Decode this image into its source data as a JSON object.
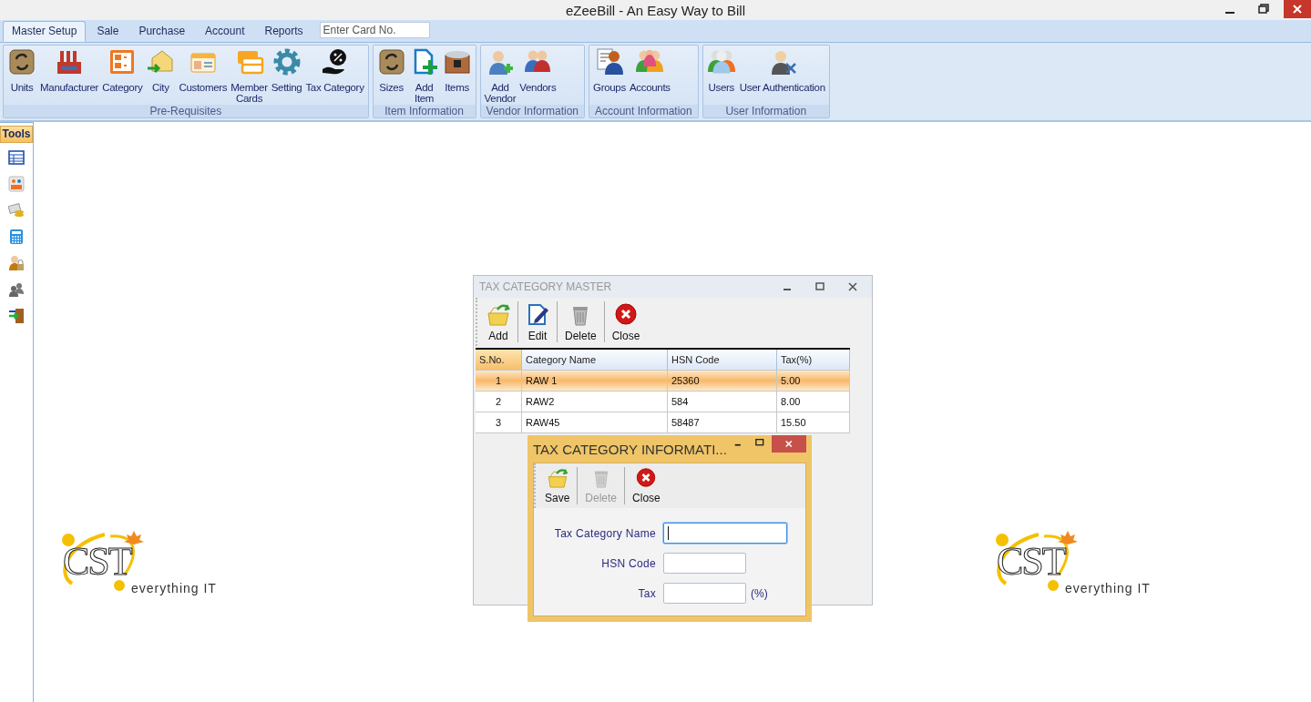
{
  "window": {
    "title": "eZeeBill - An Easy Way to Bill"
  },
  "tabs": [
    {
      "label": "Master Setup",
      "selected": true
    },
    {
      "label": "Sale",
      "selected": false
    },
    {
      "label": "Purchase",
      "selected": false
    },
    {
      "label": "Account",
      "selected": false
    },
    {
      "label": "Reports",
      "selected": false
    }
  ],
  "card_search": {
    "placeholder": "Enter Card No."
  },
  "ribbon_groups": [
    {
      "caption": "Pre-Requisites",
      "items": [
        "Units",
        "Manufacturer",
        "Category",
        "City",
        "Customers",
        "Member\nCards",
        "Setting",
        "Tax Category"
      ]
    },
    {
      "caption": "Item Information",
      "items": [
        "Sizes",
        "Add\nItem",
        "Items"
      ]
    },
    {
      "caption": "Vendor Information",
      "items": [
        "Add\nVendor",
        "Vendors"
      ]
    },
    {
      "caption": "Account Information",
      "items": [
        "Groups",
        "Accounts"
      ]
    },
    {
      "caption": "User Information",
      "items": [
        "Users",
        "User Authentication"
      ]
    }
  ],
  "tools": {
    "title": "Tools"
  },
  "logos": [
    {
      "mark": "CST",
      "tagline": "everything IT"
    },
    {
      "mark": "CST",
      "tagline": "everything IT"
    }
  ],
  "tax_master": {
    "title": "TAX CATEGORY MASTER",
    "active": false,
    "toolbar": [
      {
        "label": "Add",
        "disabled": false
      },
      {
        "label": "Edit",
        "disabled": false
      },
      {
        "label": "Delete",
        "disabled": false
      },
      {
        "label": "Close",
        "disabled": false
      }
    ],
    "columns": [
      "S.No.",
      "Category Name",
      "HSN Code",
      "Tax(%)"
    ],
    "rows": [
      {
        "cells": [
          "1",
          "RAW 1",
          "25360",
          "5.00"
        ],
        "selected": true
      },
      {
        "cells": [
          "2",
          "RAW2",
          "584",
          "8.00"
        ],
        "selected": false
      },
      {
        "cells": [
          "3",
          "RAW45",
          "58487",
          "15.50"
        ],
        "selected": false
      }
    ]
  },
  "tax_info": {
    "title": "TAX CATEGORY INFORMATI...",
    "active": true,
    "toolbar": [
      {
        "label": "Save",
        "disabled": false
      },
      {
        "label": "Delete",
        "disabled": true
      },
      {
        "label": "Close",
        "disabled": false
      }
    ],
    "fields": [
      {
        "label": "Tax Category Name",
        "focused": true
      },
      {
        "label": "HSN Code",
        "focused": false
      },
      {
        "label": "Tax",
        "focused": false,
        "suffix": "(%)"
      }
    ]
  }
}
